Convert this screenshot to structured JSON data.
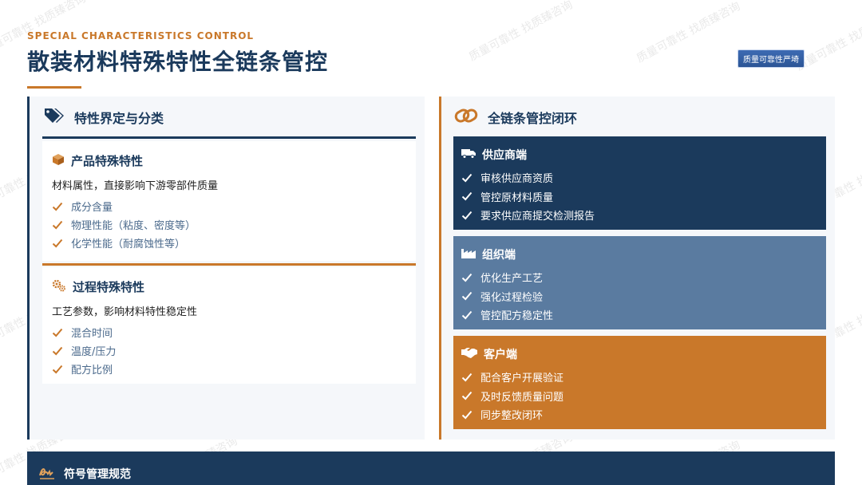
{
  "header": {
    "kicker": "SPECIAL CHARACTERISTICS CONTROL",
    "title": "散装材料特殊特性全链条管控"
  },
  "tag": "质量可靠性严埼",
  "watermark": "质量可靠性 找质臻咨询",
  "left": {
    "title": "特性界定与分类",
    "product": {
      "title": "产品特殊特性",
      "desc": "材料属性，直接影响下游零部件质量",
      "items": [
        "成分含量",
        "物理性能（粘度、密度等）",
        "化学性能（耐腐蚀性等）"
      ]
    },
    "process": {
      "title": "过程特殊特性",
      "desc": "工艺参数，影响材料特性稳定性",
      "items": [
        "混合时间",
        "温度/压力",
        "配方比例"
      ]
    }
  },
  "right": {
    "title": "全链条管控闭环",
    "supplier": {
      "title": "供应商端",
      "items": [
        "审核供应商资质",
        "管控原材料质量",
        "要求供应商提交检测报告"
      ]
    },
    "org": {
      "title": "组织端",
      "items": [
        "优化生产工艺",
        "强化过程检验",
        "管控配方稳定性"
      ]
    },
    "customer": {
      "title": "客户端",
      "items": [
        "配合客户开展验证",
        "及时反馈质量问题",
        "同步整改闭环"
      ]
    }
  },
  "bottom": {
    "title": "符号管理规范"
  },
  "colors": {
    "navy": "#1b3a5c",
    "orange": "#c9782a",
    "steel": "#5a7ba0"
  },
  "icons": {
    "left_header": "tags-icon",
    "product": "cube-icon",
    "process": "gears-icon",
    "right_header": "link-icon",
    "supplier": "truck-icon",
    "org": "factory-icon",
    "customer": "handshake-icon",
    "bottom": "signature-icon"
  }
}
